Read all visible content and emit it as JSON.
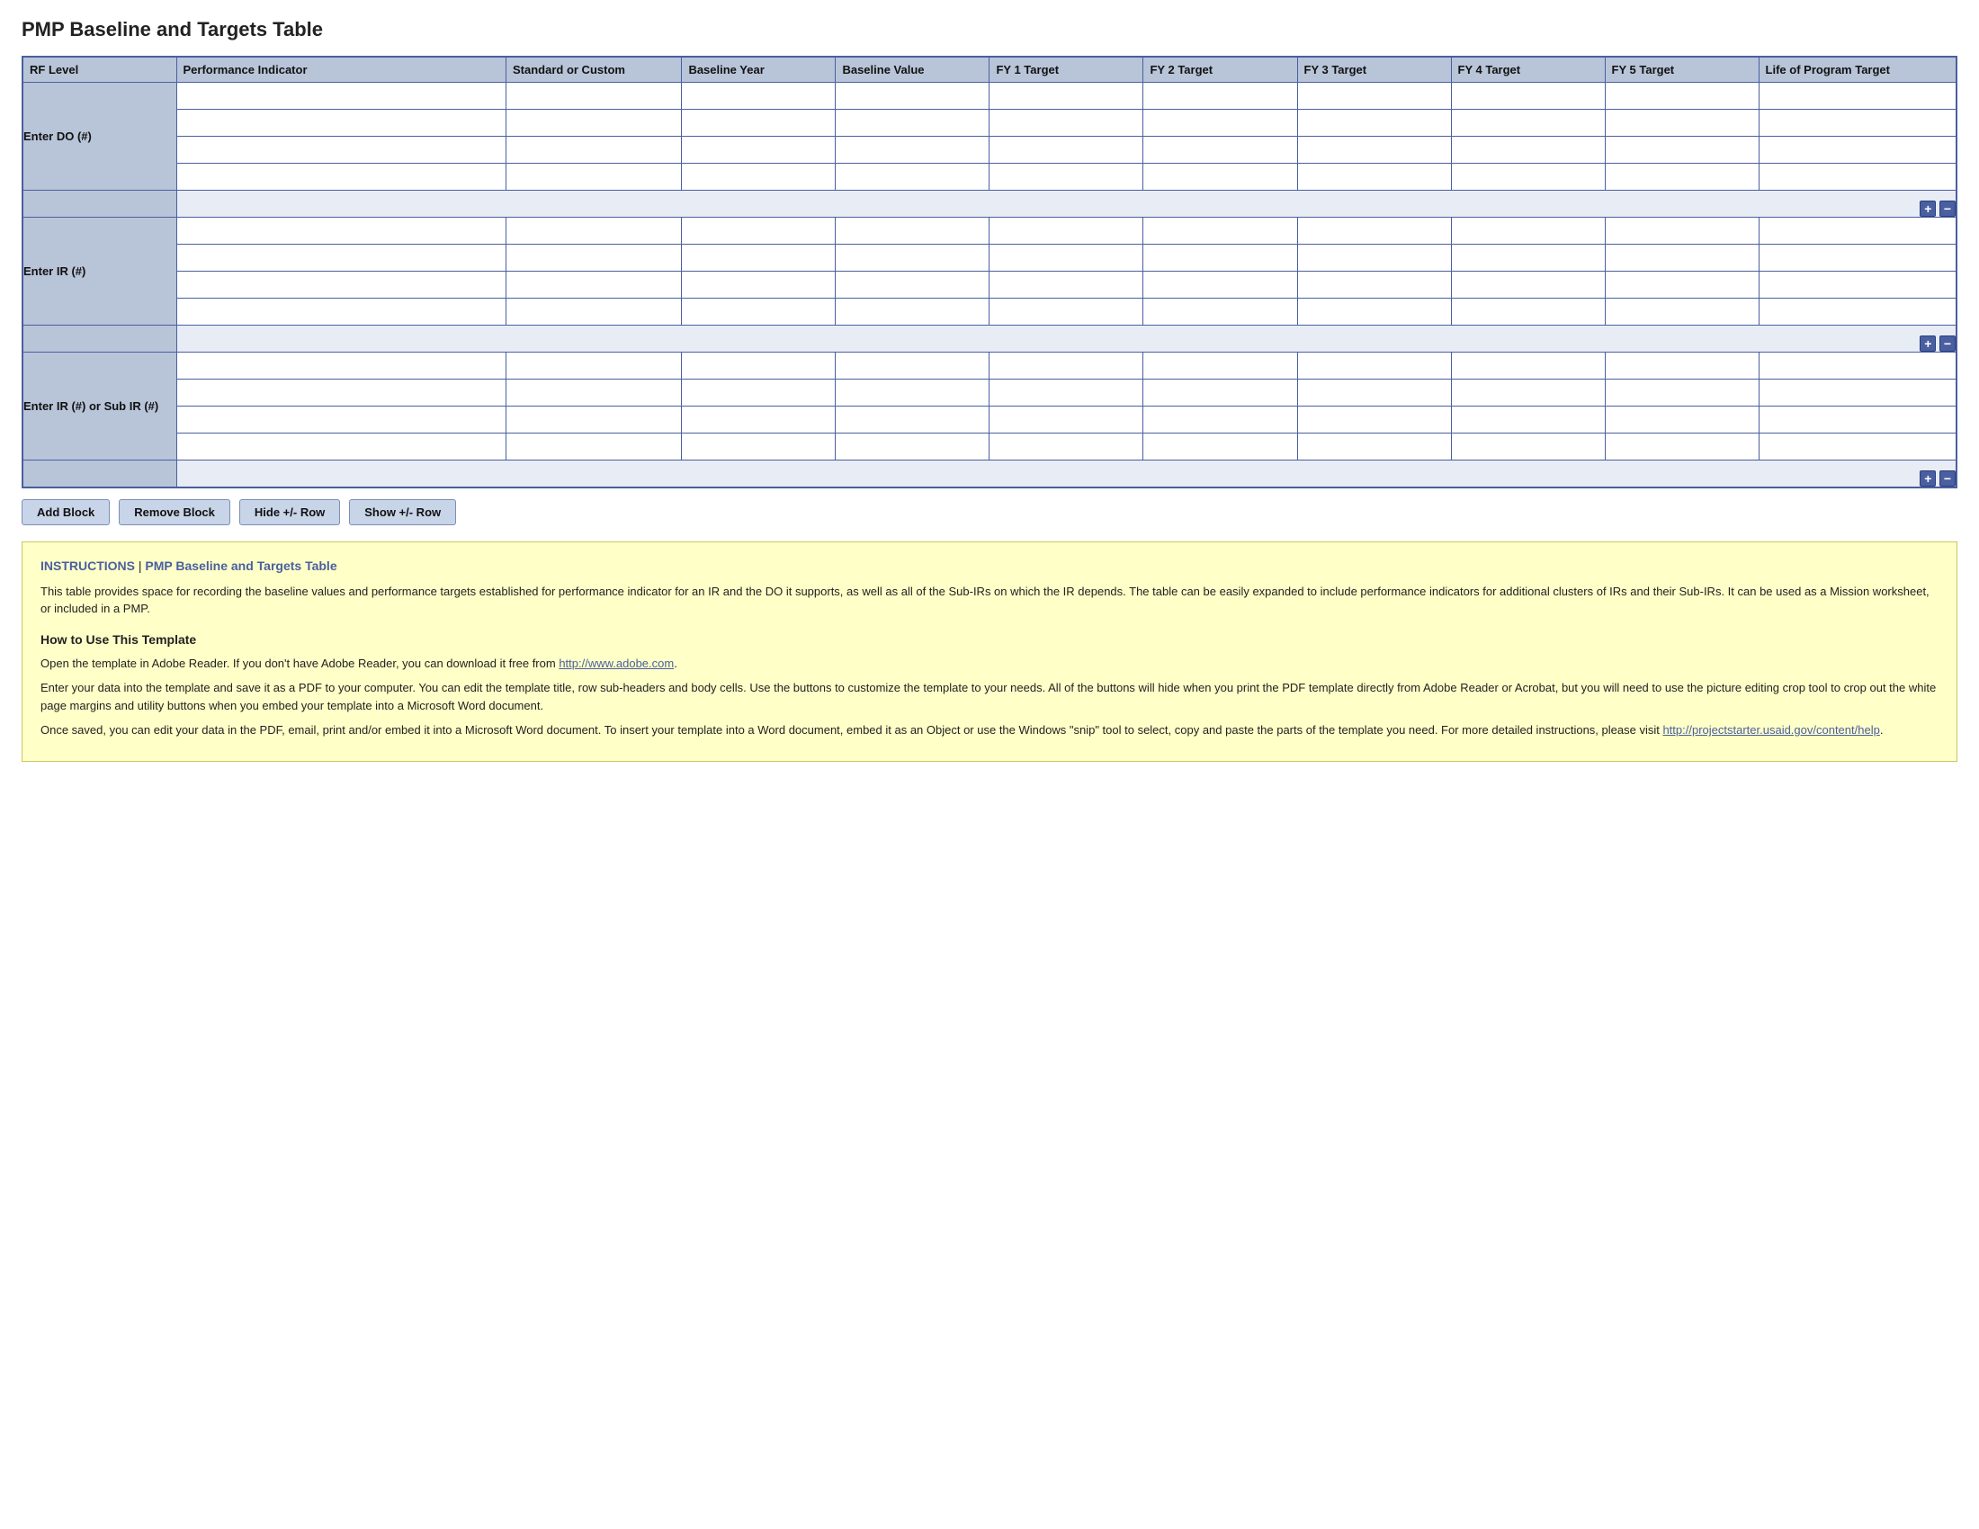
{
  "page": {
    "title": "PMP Baseline and Targets Table"
  },
  "table": {
    "headers": {
      "rf_level": "RF Level",
      "performance_indicator": "Performance Indicator",
      "standard_or_custom": "Standard or Custom",
      "baseline_year": "Baseline Year",
      "baseline_value": "Baseline Value",
      "fy1": "FY 1 Target",
      "fy2": "FY 2 Target",
      "fy3": "FY 3 Target",
      "fy4": "FY 4 Target",
      "fy5": "FY 5 Target",
      "life_of_program": "Life of Program Target"
    },
    "sections": [
      {
        "id": "section-do",
        "label": "Enter DO (#)",
        "rows": 4
      },
      {
        "id": "section-ir",
        "label": "Enter IR (#)",
        "rows": 4
      },
      {
        "id": "section-ir-sub",
        "label": "Enter IR (#) or Sub IR (#)",
        "rows": 4
      }
    ]
  },
  "buttons": {
    "add_block": "Add Block",
    "remove_block": "Remove Block",
    "hide_row": "Hide +/- Row",
    "show_row": "Show +/- Row"
  },
  "instructions": {
    "header_bold": "INSTRUCTIONS",
    "header_title": "PMP Baseline and Targets Table",
    "body": "This table provides space for recording the baseline values and performance targets established for performance indicator for an IR and the DO it supports, as well as all of the Sub-IRs on which the IR depends. The table can be easily expanded to include performance indicators for additional clusters of IRs and their Sub-IRs. It can be used as a Mission worksheet, or included in a PMP.",
    "how_to_title": "How to Use This Template",
    "how_to_p1": "Open the template in Adobe Reader. If you don't have Adobe Reader, you can download it free from ",
    "how_to_link": "http://www.adobe.com",
    "how_to_link_end": ".",
    "how_to_p2": "Enter your data into the template and save it as a PDF to your computer. You can edit the template title, row sub-headers and body cells. Use the buttons to customize the template to your needs. All of the buttons will hide when you print the PDF template directly from Adobe Reader or Acrobat, but you will need to use the picture editing crop tool to crop out the white page margins and utility buttons when you embed your template into a Microsoft Word document.",
    "how_to_p3": "Once saved, you can edit your data in the PDF, email, print and/or embed it into a Microsoft Word document. To insert your template into a Word document, embed it as an Object or use the Windows \"snip\" tool to select, copy and paste the parts of the template you need. For more detailed instructions, please visit ",
    "how_to_link2": "http://projectstarter.usaid.gov/content/help",
    "how_to_link2_end": "."
  }
}
